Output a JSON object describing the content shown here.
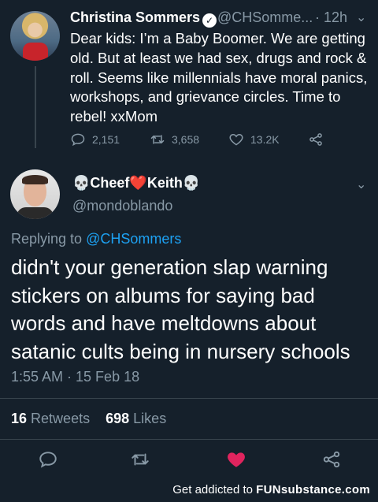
{
  "parent_tweet": {
    "author_name": "Christina Sommers",
    "handle": "@CHSomme...",
    "separator": "·",
    "time": "12h",
    "text": "Dear kids: I’m a Baby Boomer. We are getting old. But at least we had sex, drugs and rock & roll. Seems like millennials have moral panics, workshops, and grievance circles. Time to rebel! xxMom",
    "replies": "2,151",
    "retweets": "3,658",
    "likes": "13.2K"
  },
  "main_tweet": {
    "author_name": "💀Cheef❤️Keith💀",
    "handle": "@mondoblando",
    "replying_prefix": "Replying to",
    "replying_to": "@CHSommers",
    "text": "didn't your generation slap warning stickers on albums for saying bad words and have meltdowns about satanic cults being in nursery schools",
    "timestamp": "1:55 AM · 15 Feb 18",
    "retweet_count": "16",
    "retweet_label": "Retweets",
    "like_count": "698",
    "like_label": "Likes"
  },
  "footer": {
    "prefix": "Get addicted to ",
    "brand": "FUNsubstance.com"
  },
  "colors": {
    "background": "#15202b",
    "muted": "#8899a6",
    "link": "#1da1f2",
    "like": "#e0245e",
    "divider": "#38444d"
  },
  "icons": {
    "verified": "verified-badge-icon",
    "reply": "reply-icon",
    "retweet": "retweet-icon",
    "like": "heart-icon",
    "share": "share-icon",
    "chevron": "chevron-down-icon"
  }
}
